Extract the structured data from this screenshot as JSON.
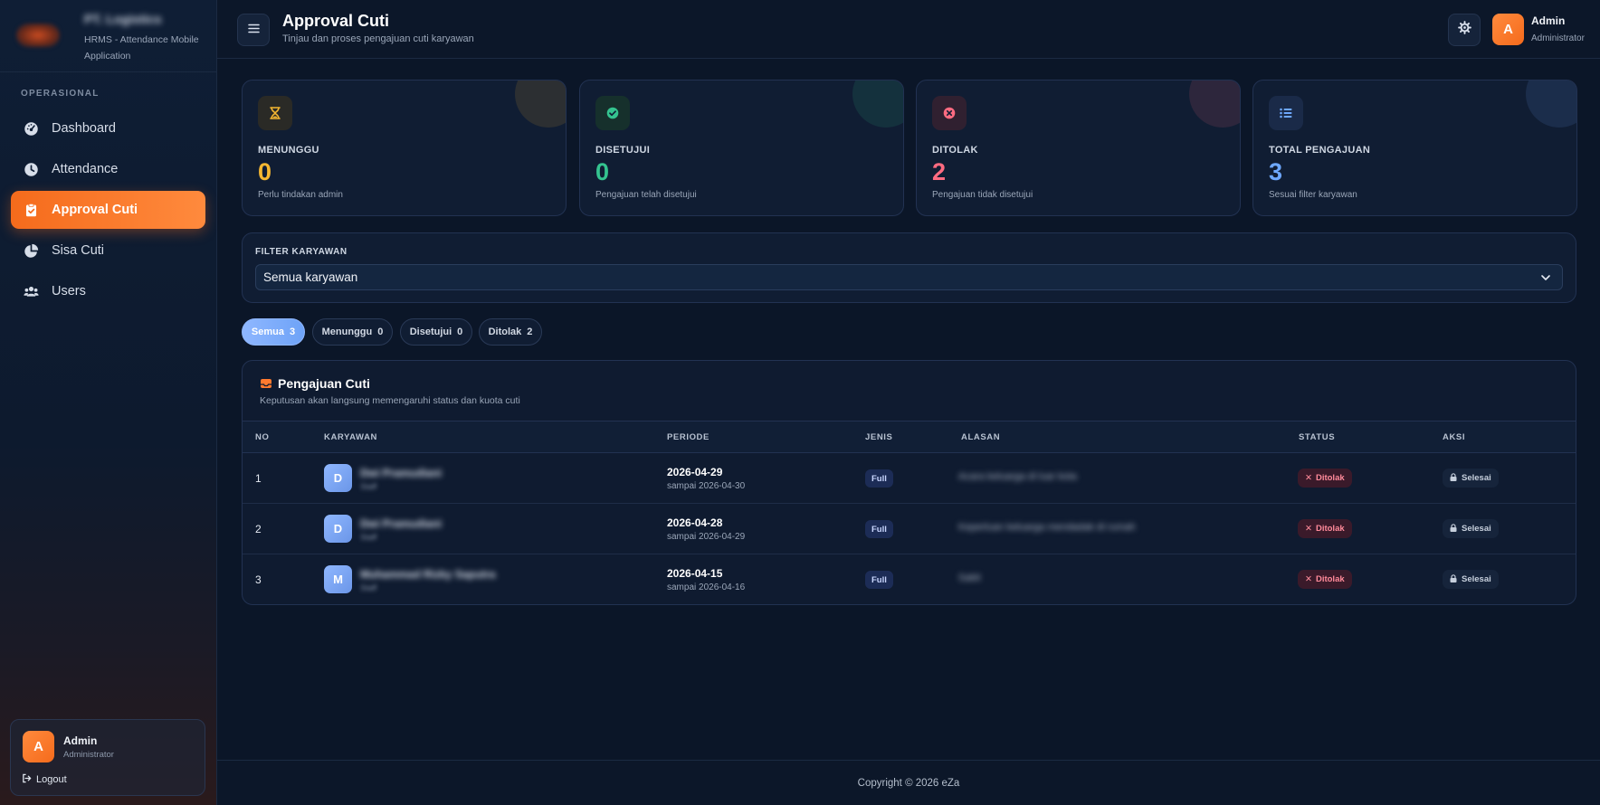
{
  "sidebar": {
    "brand_name": "PT. Logistics",
    "brand_sub": "HRMS - Attendance Mobile Application",
    "section": "OPERASIONAL",
    "items": [
      {
        "label": "Dashboard",
        "icon": "dashboard-gauge-icon"
      },
      {
        "label": "Attendance",
        "icon": "clock-icon"
      },
      {
        "label": "Approval Cuti",
        "icon": "clipboard-check-icon",
        "active": true
      },
      {
        "label": "Sisa Cuti",
        "icon": "pie-chart-icon"
      },
      {
        "label": "Users",
        "icon": "users-icon"
      }
    ],
    "user": {
      "initial": "A",
      "name": "Admin",
      "role": "Administrator",
      "logout": "Logout"
    }
  },
  "header": {
    "title": "Approval Cuti",
    "subtitle": "Tinjau dan proses pengajuan cuti karyawan",
    "user": {
      "initial": "A",
      "name": "Admin",
      "role": "Administrator"
    }
  },
  "stats": [
    {
      "label": "MENUNGGU",
      "value": "0",
      "desc": "Perlu tindakan admin",
      "color": "#f5b731",
      "icon": "hourglass-icon"
    },
    {
      "label": "DISETUJUI",
      "value": "0",
      "desc": "Pengajuan telah disetujui",
      "color": "#34c38f",
      "icon": "check-circle-icon"
    },
    {
      "label": "DITOLAK",
      "value": "2",
      "desc": "Pengajuan tidak disetujui",
      "color": "#ff6b81",
      "icon": "x-circle-icon"
    },
    {
      "label": "TOTAL PENGAJUAN",
      "value": "3",
      "desc": "Sesuai filter karyawan",
      "color": "#6ea8ff",
      "icon": "list-icon"
    }
  ],
  "filter": {
    "label": "FILTER KARYAWAN",
    "selected": "Semua karyawan"
  },
  "tabs": [
    {
      "label": "Semua",
      "count": "3",
      "active": true
    },
    {
      "label": "Menunggu",
      "count": "0"
    },
    {
      "label": "Disetujui",
      "count": "0"
    },
    {
      "label": "Ditolak",
      "count": "2"
    }
  ],
  "table": {
    "title": "Pengajuan Cuti",
    "subtitle": "Keputusan akan langsung memengaruhi status dan kuota cuti",
    "columns": [
      "NO",
      "KARYAWAN",
      "PERIODE",
      "JENIS",
      "ALASAN",
      "STATUS",
      "AKSI"
    ],
    "rows": [
      {
        "no": "1",
        "initial": "D",
        "name": "Dwi Pramudiani",
        "sub": "Staff",
        "period_start": "2026-04-29",
        "period_end": "sampai 2026-04-30",
        "jenis": "Full",
        "alasan": "Acara keluarga di luar kota",
        "status": "Ditolak",
        "aksi": "Selesai"
      },
      {
        "no": "2",
        "initial": "D",
        "name": "Dwi Pramudiani",
        "sub": "Staff",
        "period_start": "2026-04-28",
        "period_end": "sampai 2026-04-29",
        "jenis": "Full",
        "alasan": "Keperluan keluarga mendadak di rumah",
        "status": "Ditolak",
        "aksi": "Selesai"
      },
      {
        "no": "3",
        "initial": "M",
        "name": "Muhammad Rizky Saputra",
        "sub": "Staff",
        "period_start": "2026-04-15",
        "period_end": "sampai 2026-04-16",
        "jenis": "Full",
        "alasan": "Sakit",
        "status": "Ditolak",
        "aksi": "Selesai"
      }
    ]
  },
  "footer": {
    "text": "Copyright © 2026 eZa"
  }
}
